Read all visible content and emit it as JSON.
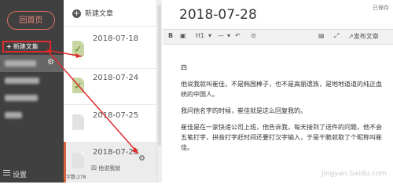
{
  "sidebar": {
    "home_label": "回首页",
    "new_collection_label": "新建文集",
    "settings_label": "设置"
  },
  "list": {
    "new_article_label": "新建文章",
    "items": [
      {
        "date": "2018-07-18"
      },
      {
        "date": "2018-07-24"
      },
      {
        "date": "2018-07-25"
      },
      {
        "date": "2018-07-28",
        "snippet": "四 他说我就",
        "word_count": "字数:278"
      }
    ]
  },
  "editor": {
    "saved_status": "已保存",
    "title": "2018-07-28",
    "toolbar": {
      "heading": "H1",
      "publish": "发布文章"
    },
    "paragraphs": [
      "四",
      "他说我就叫崔佳，不是韩国棒子，也不是高丽遗族，是地地道道的纯正血统的中国人。",
      "我问他名字的时候，崔佳就是这么回复我的。",
      "崔佳是在一家快递公司上班，他告诉我，每天接到了送件的问题，他不会五笔打字，拼音打字赶时间还要打汉字输入，于是干脆就取了个昵称叫崔佳。"
    ]
  },
  "watermark": "jingyan.baidu.com",
  "colors": {
    "accent": "#d8633f",
    "highlight": "#e02b2b",
    "sidebar_bg": "#404040"
  }
}
